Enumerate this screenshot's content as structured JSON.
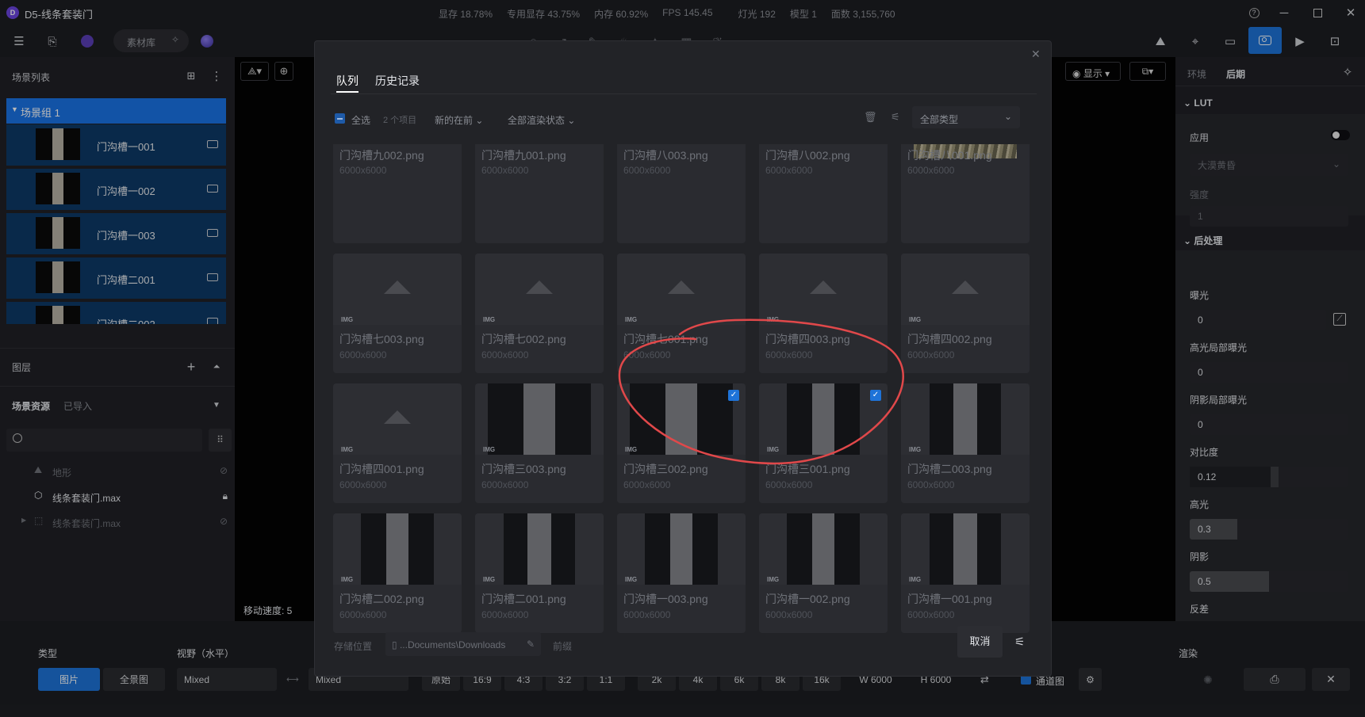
{
  "app": {
    "title": "D5-线条套装门",
    "logo": "D5"
  },
  "stats": {
    "vram": "显存 18.78%",
    "dedicated_vram": "专用显存 43.75%",
    "memory": "内存 60.92%",
    "fps": "FPS 145.45",
    "lights": "灯光 192",
    "models": "模型 1",
    "faces": "面数 3,155,760"
  },
  "toolbar": {
    "library_label": "素材库"
  },
  "left_panel": {
    "scene_list_title": "场景列表",
    "group_name": "场景组 1",
    "scenes": [
      "门沟槽一001",
      "门沟槽一002",
      "门沟槽一003",
      "门沟槽二001",
      "门沟槽二002"
    ],
    "layers_title": "图层",
    "assets_tab": "场景资源",
    "imported_tab": "已导入",
    "assets": [
      "地形",
      "线条套装门.max",
      "线条套装门.max"
    ]
  },
  "viewport": {
    "move_speed": "移动速度: 5",
    "display_label": "显示"
  },
  "right_panel": {
    "tab_env": "环境",
    "tab_post": "后期",
    "lut_title": "LUT",
    "apply_label": "应用",
    "lut_preset": "大漠黄昏",
    "strength_label": "强度",
    "strength_value": "1",
    "post_title": "后处理",
    "exposure_label": "曝光",
    "exposure_value": "0",
    "hl_exposure_label": "高光局部曝光",
    "hl_exposure_value": "0",
    "shadow_exposure_label": "阴影局部曝光",
    "shadow_exposure_value": "0",
    "contrast_label": "对比度",
    "contrast_value": "0.12",
    "contrast_level": 0.56,
    "highlight_label": "高光",
    "highlight_value": "0.3",
    "highlight_level": 0.3,
    "shadow_label": "阴影",
    "shadow_value": "0.5",
    "shadow_level": 0.5,
    "reflect_label": "反差"
  },
  "bottom": {
    "type_label": "类型",
    "fov_label": "视野（水平）",
    "render_label": "渲染",
    "btn_image": "图片",
    "btn_pano": "全景图",
    "fov_value": "Mixed",
    "mixed2": "Mixed",
    "ratios": [
      "原始",
      "16:9",
      "4:3",
      "3:2",
      "1:1"
    ],
    "sizes": [
      "2k",
      "4k",
      "6k",
      "8k",
      "16k"
    ],
    "width": "W  6000",
    "height": "H  6000",
    "channel_label": "通道图"
  },
  "dialog": {
    "tab_queue": "队列",
    "tab_history": "历史记录",
    "select_all": "全选",
    "count": "2 个项目",
    "sort": "新的在前",
    "status_filter": "全部渲染状态",
    "type_filter": "全部类型",
    "save_location_label": "存储位置",
    "save_path": "...Documents\\Downloads",
    "prefix_label": "前缀",
    "cancel": "取消",
    "badge": "IMG",
    "items": [
      {
        "name": "门沟槽九002.png",
        "dim": "6000x6000"
      },
      {
        "name": "门沟槽九001.png",
        "dim": "6000x6000"
      },
      {
        "name": "门沟槽八003.png",
        "dim": "6000x6000"
      },
      {
        "name": "门沟槽八002.png",
        "dim": "6000x6000"
      },
      {
        "name": "门沟槽八001.png",
        "dim": "6000x6000"
      },
      {
        "name": "门沟槽七003.png",
        "dim": "6000x6000"
      },
      {
        "name": "门沟槽七002.png",
        "dim": "6000x6000"
      },
      {
        "name": "门沟槽七001.png",
        "dim": "6000x6000"
      },
      {
        "name": "门沟槽四003.png",
        "dim": "6000x6000"
      },
      {
        "name": "门沟槽四002.png",
        "dim": "6000x6000"
      },
      {
        "name": "门沟槽四001.png",
        "dim": "6000x6000"
      },
      {
        "name": "门沟槽三003.png",
        "dim": "6000x6000"
      },
      {
        "name": "门沟槽三002.png",
        "dim": "6000x6000"
      },
      {
        "name": "门沟槽三001.png",
        "dim": "6000x6000"
      },
      {
        "name": "门沟槽二003.png",
        "dim": "6000x6000"
      },
      {
        "name": "门沟槽二002.png",
        "dim": "6000x6000"
      },
      {
        "name": "门沟槽二001.png",
        "dim": "6000x6000"
      },
      {
        "name": "门沟槽一003.png",
        "dim": "6000x6000"
      },
      {
        "name": "门沟槽一002.png",
        "dim": "6000x6000"
      },
      {
        "name": "门沟槽一001.png",
        "dim": "6000x6000"
      }
    ]
  },
  "colors": {
    "accent": "#1e73d8",
    "annotation": "#e0484a"
  }
}
